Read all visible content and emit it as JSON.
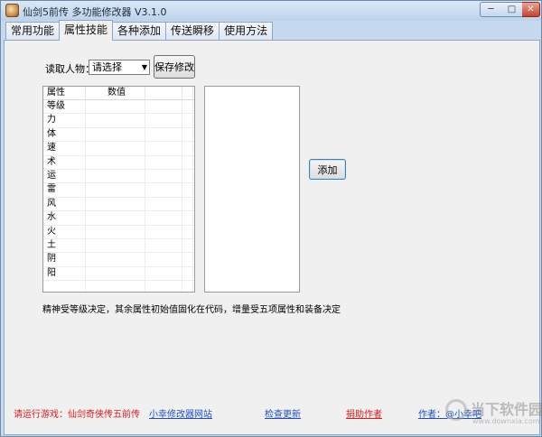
{
  "window": {
    "title": "仙剑5前传 多功能修改器 V3.1.0",
    "controls": {
      "minimize": "─",
      "maximize": "□",
      "close": "✕"
    }
  },
  "tabs": [
    {
      "label": "常用功能",
      "active": false
    },
    {
      "label": "属性技能",
      "active": true
    },
    {
      "label": "各种添加",
      "active": false
    },
    {
      "label": "传送瞬移",
      "active": false
    },
    {
      "label": "使用方法",
      "active": false
    }
  ],
  "form": {
    "read_label": "读取人物：",
    "character_select": "请选择",
    "save_button": "保存修改",
    "add_button": "添加"
  },
  "grid": {
    "headers": [
      "属性",
      "数值",
      "",
      ""
    ],
    "rows": [
      [
        "等级",
        ""
      ],
      [
        "力",
        ""
      ],
      [
        "体",
        ""
      ],
      [
        "速",
        ""
      ],
      [
        "术",
        ""
      ],
      [
        "运",
        ""
      ],
      [
        "雷",
        ""
      ],
      [
        "风",
        ""
      ],
      [
        "水",
        ""
      ],
      [
        "火",
        ""
      ],
      [
        "土",
        ""
      ],
      [
        "阴",
        ""
      ],
      [
        "阳",
        ""
      ],
      [
        "",
        ""
      ]
    ]
  },
  "note": "精神受等级决定，其余属性初始值固化在代码，增量受五项属性和装备决定",
  "footer": {
    "running": "请运行游戏：仙剑奇侠传五前传",
    "site": "小幸修改器网站",
    "update": "检查更新",
    "donate": "捐助作者",
    "author": "作者：@小幸吧"
  },
  "watermark": {
    "name": "当下软件园",
    "url": "www.downxia.com"
  },
  "colors": {
    "link": "#1f4fc7",
    "warning": "#e01b1b"
  }
}
